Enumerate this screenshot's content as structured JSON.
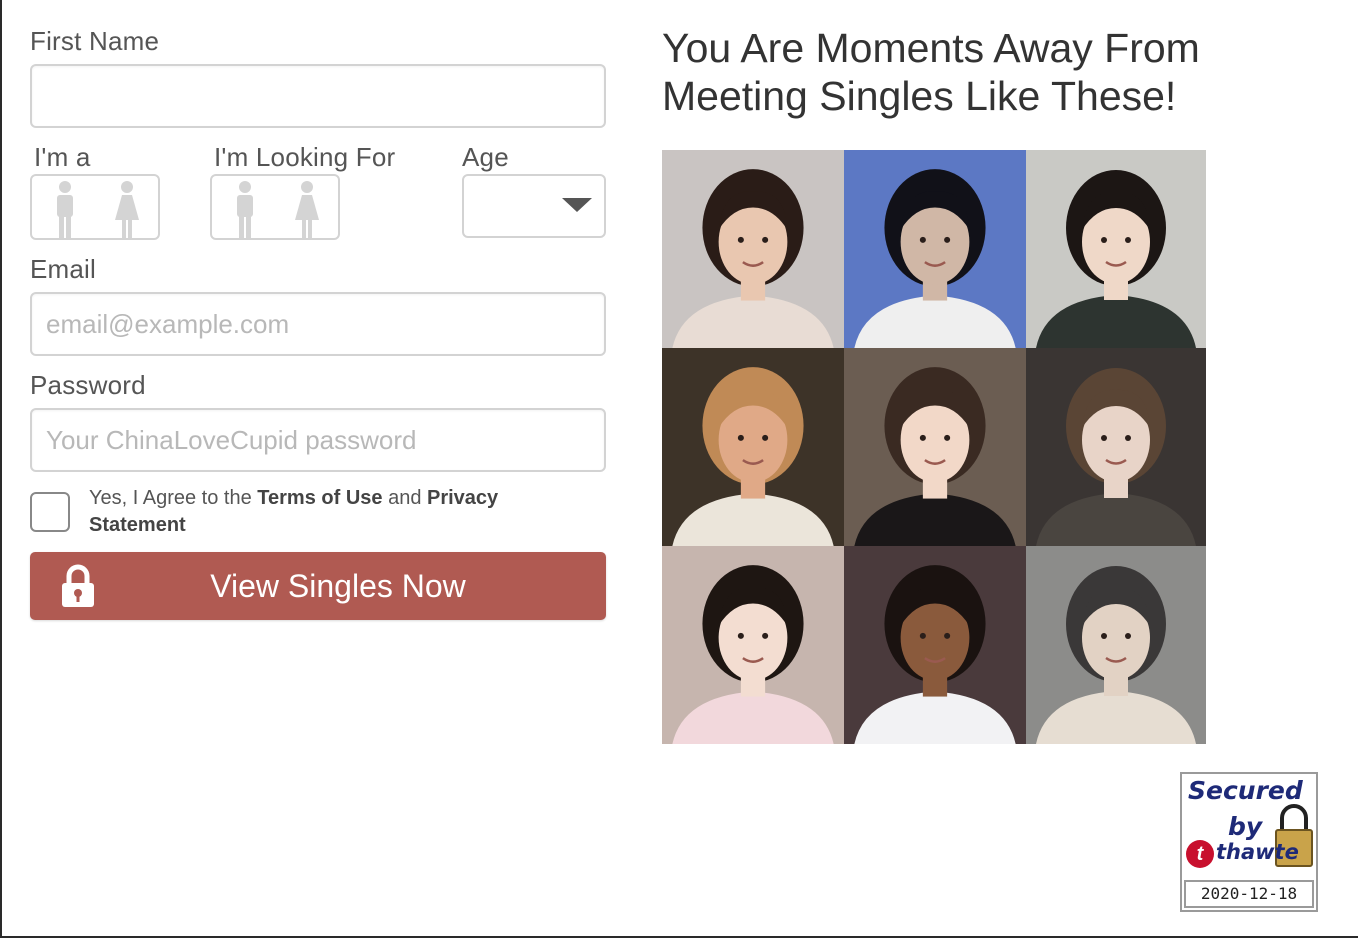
{
  "form": {
    "first_name_label": "First Name",
    "first_name_value": "",
    "im_a_label": "I'm a",
    "looking_for_label": "I'm Looking For",
    "age_label": "Age",
    "age_value": "",
    "email_label": "Email",
    "email_placeholder": "email@example.com",
    "password_label": "Password",
    "password_placeholder": "Your ChinaLoveCupid password",
    "agree_prefix": "Yes, I Agree to the ",
    "terms_link": "Terms of Use",
    "agree_and": " and ",
    "privacy_link": "Privacy Statement",
    "submit_label": "View Singles Now"
  },
  "gender_icons": [
    "male-icon",
    "female-icon"
  ],
  "headline": "You Are Moments Away From Meeting Singles Like These!",
  "photos": [
    {
      "name": "single-photo-1",
      "bg": "#c9c4c2",
      "skin": "#e9c7b0",
      "hair": "#2a1c17",
      "shirt": "#e8dcd4"
    },
    {
      "name": "single-photo-2",
      "bg": "#5c78c4",
      "skin": "#d0b7a6",
      "hair": "#111118",
      "shirt": "#efefef"
    },
    {
      "name": "single-photo-3",
      "bg": "#c9c9c5",
      "skin": "#efd8c8",
      "hair": "#1c1614",
      "shirt": "#2d3430"
    },
    {
      "name": "single-photo-4",
      "bg": "#3d3328",
      "skin": "#e0a987",
      "hair": "#c08a56",
      "shirt": "#ebe5da"
    },
    {
      "name": "single-photo-5",
      "bg": "#6b5d52",
      "skin": "#f2d8c8",
      "hair": "#3a2a22",
      "shirt": "#1a1718"
    },
    {
      "name": "single-photo-6",
      "bg": "#3a3533",
      "skin": "#e8d4c8",
      "hair": "#5a4535",
      "shirt": "#4a4540"
    },
    {
      "name": "single-photo-7",
      "bg": "#c6b5ae",
      "skin": "#f3ddd1",
      "hair": "#1e1612",
      "shirt": "#f2d8dc"
    },
    {
      "name": "single-photo-8",
      "bg": "#4a3a3c",
      "skin": "#8a5a3c",
      "hair": "#1a1210",
      "shirt": "#f2f2f4"
    },
    {
      "name": "single-photo-9",
      "bg": "#8c8c8a",
      "skin": "#e2d2c4",
      "hair": "#3a3838",
      "shirt": "#e6ddd2"
    }
  ],
  "seal": {
    "line1": "Secured",
    "line2": "by",
    "brand": "thawte",
    "date": "2020-12-18",
    "brand_color": "#1e2a78",
    "accent_color": "#c8102e"
  },
  "colors": {
    "cta": "#b05a52",
    "input_border": "#d3d3d3",
    "placeholder": "#b8b8b8"
  }
}
